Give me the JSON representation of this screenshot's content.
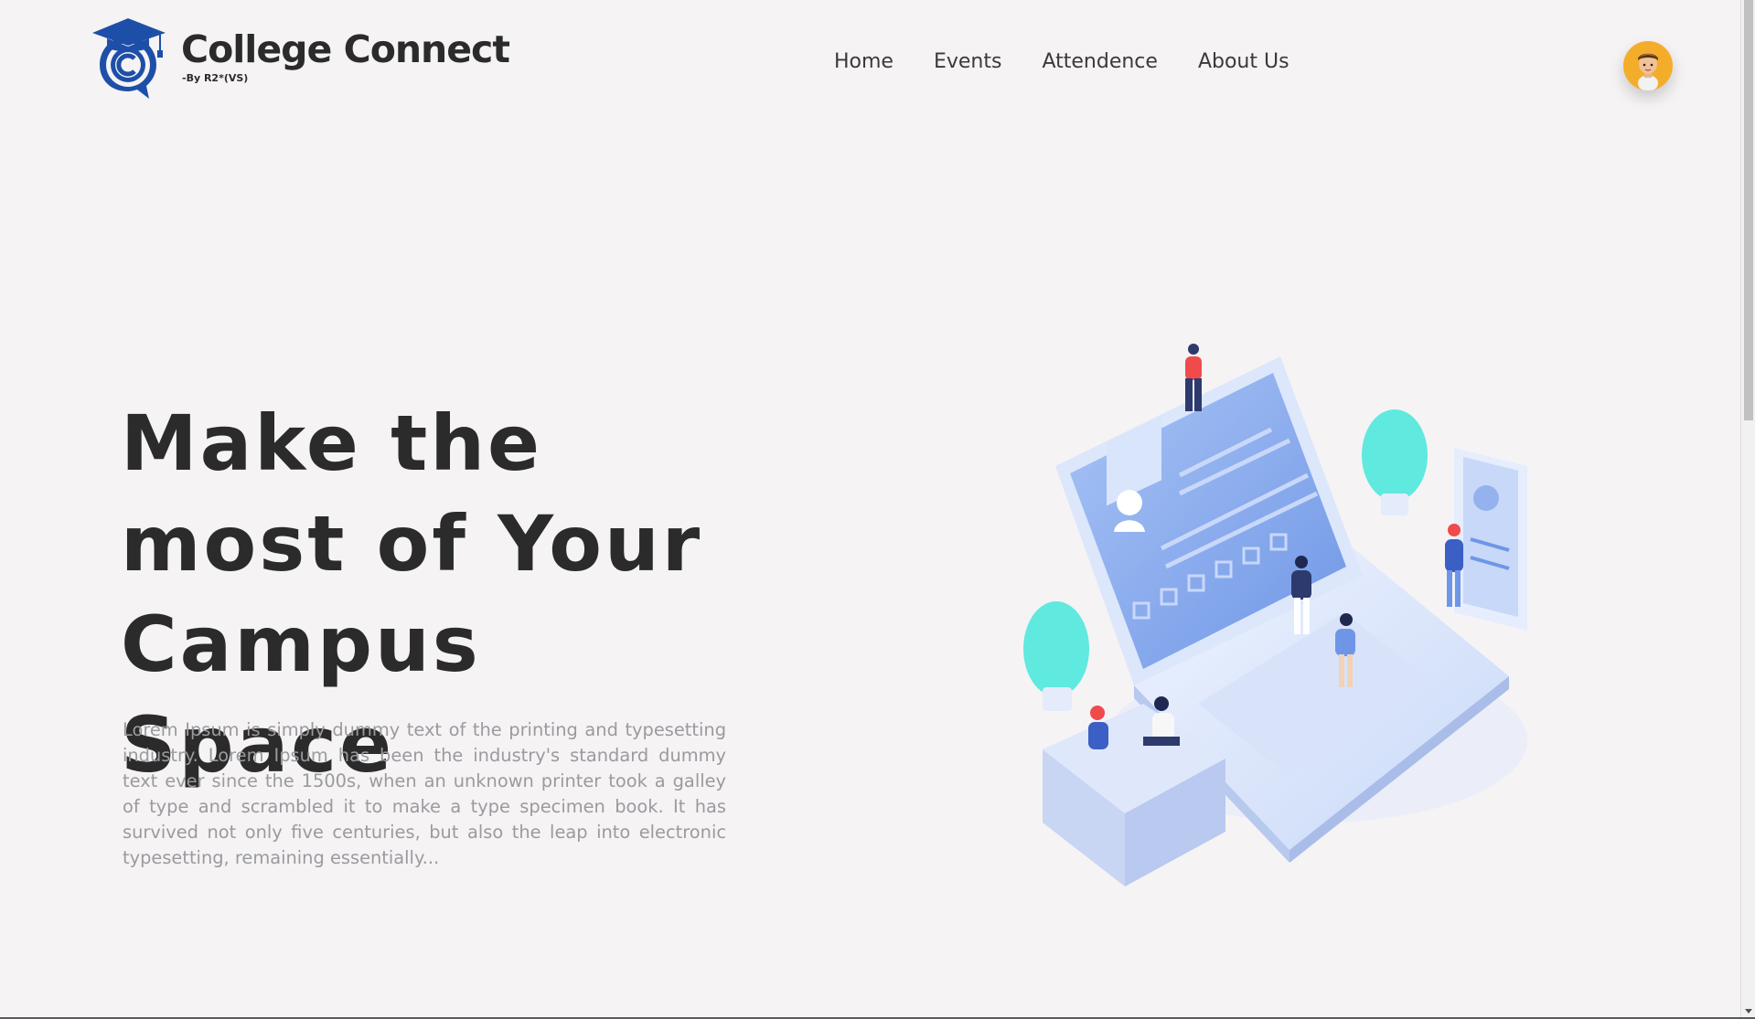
{
  "brand": {
    "title": "College Connect",
    "subtitle": "-By R2*(VS)",
    "accent_color": "#1e4fa8"
  },
  "nav": {
    "items": [
      {
        "label": "Home"
      },
      {
        "label": "Events"
      },
      {
        "label": "Attendence"
      },
      {
        "label": "About Us"
      }
    ]
  },
  "avatar": {
    "icon": "user-avatar-icon",
    "color": "#f4ac2b"
  },
  "hero": {
    "title_line1": "Make the",
    "title_line2": "most of Your",
    "title_line3": "Campus Space",
    "text": "Lorem Ipsum is simply dummy text of the printing and typesetting industry. Lorem Ipsum has been the industry's standard dummy text ever since the 1500s, when an unknown printer took a galley of type and scrambled it to make a type specimen book. It has survived not only five centuries, but also the leap into electronic typesetting, remaining essentially..."
  },
  "illustration": {
    "icon": "isometric-laptop-people-illustration"
  }
}
